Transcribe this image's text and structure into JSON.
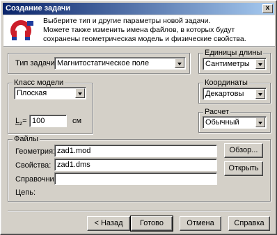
{
  "window": {
    "title": "Создание задачи",
    "close_symbol": "x"
  },
  "header": {
    "line1": "Выберите тип и другие параметры новой задачи.",
    "line2": "Можете также изменить имена файлов, в которых будут",
    "line3": "сохранены геометрическая модель и физические свойства."
  },
  "task_type": {
    "label": "Тип задачи:",
    "value": "Магнитостатическое поле"
  },
  "length_units": {
    "title": "Единицы длины",
    "value": "Сантиметры"
  },
  "model_class": {
    "title": "Класс модели",
    "value": "Плоская",
    "lz_label": "L",
    "lz_sub": "z",
    "lz_eq": "=",
    "lz_value": "100",
    "lz_unit": "см"
  },
  "coordinates": {
    "title": "Координаты",
    "value": "Декартовы"
  },
  "calculation": {
    "title": "Расчет",
    "value": "Обычный"
  },
  "files": {
    "title": "Файлы",
    "geometry_label": "Геометрия:",
    "geometry_value": "zad1.mod",
    "properties_label": "Свойства:",
    "properties_value": "zad1.dms",
    "reference_label": "Справочник:",
    "reference_value": "",
    "chain_label": "Цепь:",
    "browse_button": "Обзор...",
    "open_button": "Открыть"
  },
  "buttons": {
    "back": "< Назад",
    "done": "Готово",
    "cancel": "Отмена",
    "help": "Справка"
  },
  "colors": {
    "face": "#d4d0c8",
    "title_start": "#0a246a",
    "title_end": "#a6caf0",
    "logo_red": "#cc1e2b",
    "logo_blue": "#1f3c9e"
  }
}
